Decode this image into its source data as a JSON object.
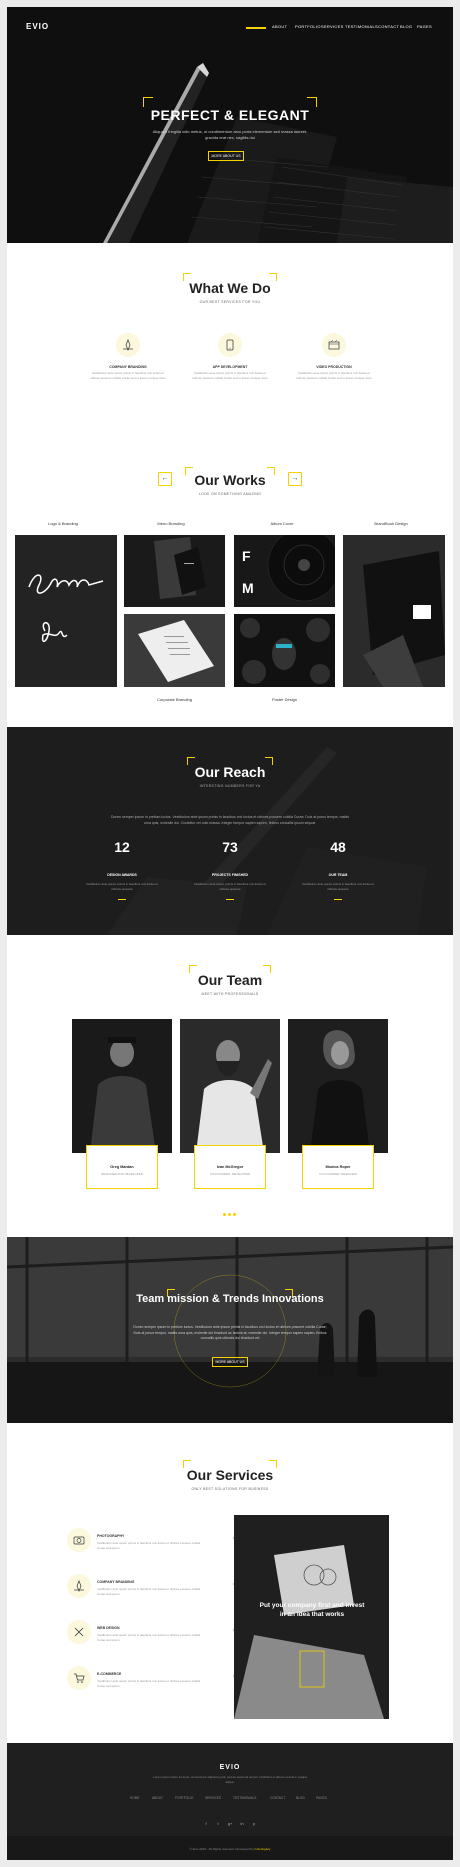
{
  "header": {
    "logo": "EVIO",
    "nav": [
      "ABOUT",
      "PORTFOLIO",
      "SERVICES",
      "TESTIMONIALS",
      "CONTACT",
      "BLOG",
      "PAGES"
    ]
  },
  "hero": {
    "title": "PERFECT & ELEGANT",
    "subtitle": "Aliquam fringilla odio metus, ut condimentum arcu porta elementum sed massa laoreet, gravida erat nec, sagittis dui",
    "button": "MORE ABOUT US"
  },
  "what_we_do": {
    "title": "What We Do",
    "subtitle": "OUR BEST SERVICES FOR YOU",
    "items": [
      {
        "icon": "design-pen-icon",
        "name": "COMPANY BRANDING",
        "desc": "Vestibulum ante ipsum primis in faucibus orci luctus et ultrices posuere cubilia Curae sed ut ipsum congue risus"
      },
      {
        "icon": "mobile-app-icon",
        "name": "APP DEVELOPMENT",
        "desc": "Vestibulum ante ipsum primis in faucibus orci luctus et ultrices posuere cubilia Curae sed ut ipsum congue risus"
      },
      {
        "icon": "video-film-icon",
        "name": "VIDEO PRODUCTION",
        "desc": "Vestibulum ante ipsum primis in faucibus orci luctus et ultrices posuere cubilia Curae sed ut ipsum congue risus"
      }
    ]
  },
  "works": {
    "title": "Our Works",
    "subtitle": "LOOK ON SOMETHING AMAZING",
    "prev": "←",
    "next": "→",
    "categories_top": [
      "Logo & Branding",
      "Menu Branding",
      "Album Cover",
      "BrandBook Design"
    ],
    "categories_bottom": [
      "Corporate Branding",
      "Poster Design"
    ]
  },
  "reach": {
    "title": "Our Reach",
    "subtitle": "INTERSTING NUMBERS FOR YA",
    "text": "Donec semper ipsum in pretium luctus. Vestibulum ante ipsum primis in faucibus orci luctus et ultrices posuere cubilia Curae; Duis at purus tempor, mattis urna quis, molestie dui. Curabitur vel odio massa. Integer tempor sapien sapien, finibus convallis ipsum sequat.",
    "stats": [
      {
        "num": "12",
        "label": "DESIGN AWARDS",
        "desc": "Vestibulum ante ipsum primis in faucibus orci luctus et ultrices posuere"
      },
      {
        "num": "73",
        "label": "PROJECTS FINISHED",
        "desc": "Vestibulum ante ipsum primis in faucibus orci luctus et ultrices posuere"
      },
      {
        "num": "48",
        "label": "OUR TEAM",
        "desc": "Vestibulum ante ipsum primis in faucibus orci luctus et ultrices posuere"
      }
    ]
  },
  "team": {
    "title": "Our Team",
    "subtitle": "MEET WITH PROFESSIONALS",
    "members": [
      {
        "name": "Greg Mardan",
        "role": "DESIGNER AND DEVELOPER"
      },
      {
        "name": "Ivan McGregor",
        "role": "CO-FOUNDER, DEVELOPER"
      },
      {
        "name": "Monica Roper",
        "role": "CO-FOUNDER, DESIGNER"
      }
    ]
  },
  "mission": {
    "title": "Team mission & Trends Innovations",
    "text": "Donec semper ipsum in pretium luctus. Vestibulum ante ipsum primis in faucibus orci luctus et ultrices posuere cubilia Curae; Duis at purus tempor, mattis urna quis, molestie dui tincidunt ac lacinia at, molestie dui. Integer tempor sapien sapien, finibus convallis quis ultricies dui tincidunt vel",
    "button": "MORE ABOUT US"
  },
  "services": {
    "title": "Our Services",
    "subtitle": "ONLY BEST SOLUTIONS FOR BUSINESS",
    "items": [
      {
        "icon": "camera-icon",
        "name": "PHOTOGRAPHY",
        "desc": "Vestibulum ante ipsum primis in faucibus orci luctus et ultrices posuere cubilia Curae sed ipsum"
      },
      {
        "icon": "design-pen-icon",
        "name": "COMPANY BRANDING",
        "desc": "Vestibulum ante ipsum primis in faucibus orci luctus et ultrices posuere cubilia Curae sed ipsum"
      },
      {
        "icon": "web-tools-icon",
        "name": "WEB DESIGN",
        "desc": "Vestibulum ante ipsum primis in faucibus orci luctus et ultrices posuere cubilia Curae sed ipsum"
      },
      {
        "icon": "cart-icon",
        "name": "E-COMMERCE",
        "desc": "Vestibulum ante ipsum primis in faucibus orci luctus et ultrices posuere cubilia Curae sed ipsum"
      }
    ],
    "image_text": "Put your company first and invest in an idea that works"
  },
  "footer": {
    "logo": "EVIO",
    "text": "Lorem ipsum dolor sit amet, consectetur adipiscing elit, sed do eiusmod tempor incididunt ut labore et dolore magna aliqua.",
    "nav": [
      "HOME",
      "ABOUT",
      "PORTFOLIO",
      "SERVICES",
      "TESTIMONIALS",
      "CONTACT",
      "BLOG",
      "PAGES"
    ],
    "social": [
      "f",
      "t",
      "g+",
      "in",
      "p"
    ],
    "copyright": "© Evio 2016 - All Rights reserved. Developed by ",
    "developer": "Colorlegacy"
  },
  "colors": {
    "accent": "#f4d200",
    "dark": "#1c1c1c"
  }
}
